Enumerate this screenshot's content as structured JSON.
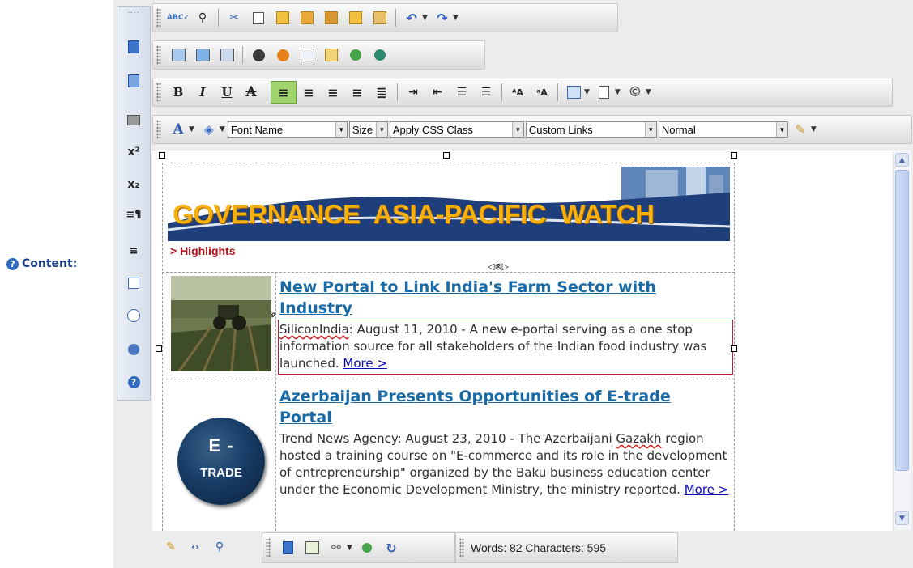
{
  "field_label": "Content:",
  "toolbar": {
    "font_name": "Font Name",
    "size": "Size",
    "css_class": "Apply CSS Class",
    "custom_links": "Custom Links",
    "paragraph_style": "Normal"
  },
  "banner": {
    "title": "GOVERNANCE  ASIA-PACIFIC  WATCH",
    "section": "> Highlights"
  },
  "articles": [
    {
      "title": "New Portal to Link India's Farm Sector with Industry",
      "source": "SiliconIndia",
      "body": ": August 11, 2010 -  A new e-portal serving as a one stop information source for all stakeholders of the Indian food industry was launched. ",
      "more": "More >"
    },
    {
      "title": "Azerbaijan Presents Opportunities of E-trade Portal",
      "body_pre": "Trend News Agency: August 23, 2010 - The Azerbaijani ",
      "spell_word": "Gazakh",
      "body_post": " region hosted a training course on \"E-commerce and its role in the development of entrepreneurship\" organized by the Baku business education center under the Economic Development Ministry, the ministry reported. ",
      "more": "More >",
      "logo_line1": "E -",
      "logo_line2": "TRADE"
    }
  ],
  "status": {
    "word_count": "Words: 82 Characters: 595"
  },
  "colors": {
    "headline": "#1a6aa6",
    "banner_text": "#f7b00c",
    "highlight_red": "#b4121b",
    "active_button": "#9fd36b",
    "selection_border": "#b3262a"
  }
}
